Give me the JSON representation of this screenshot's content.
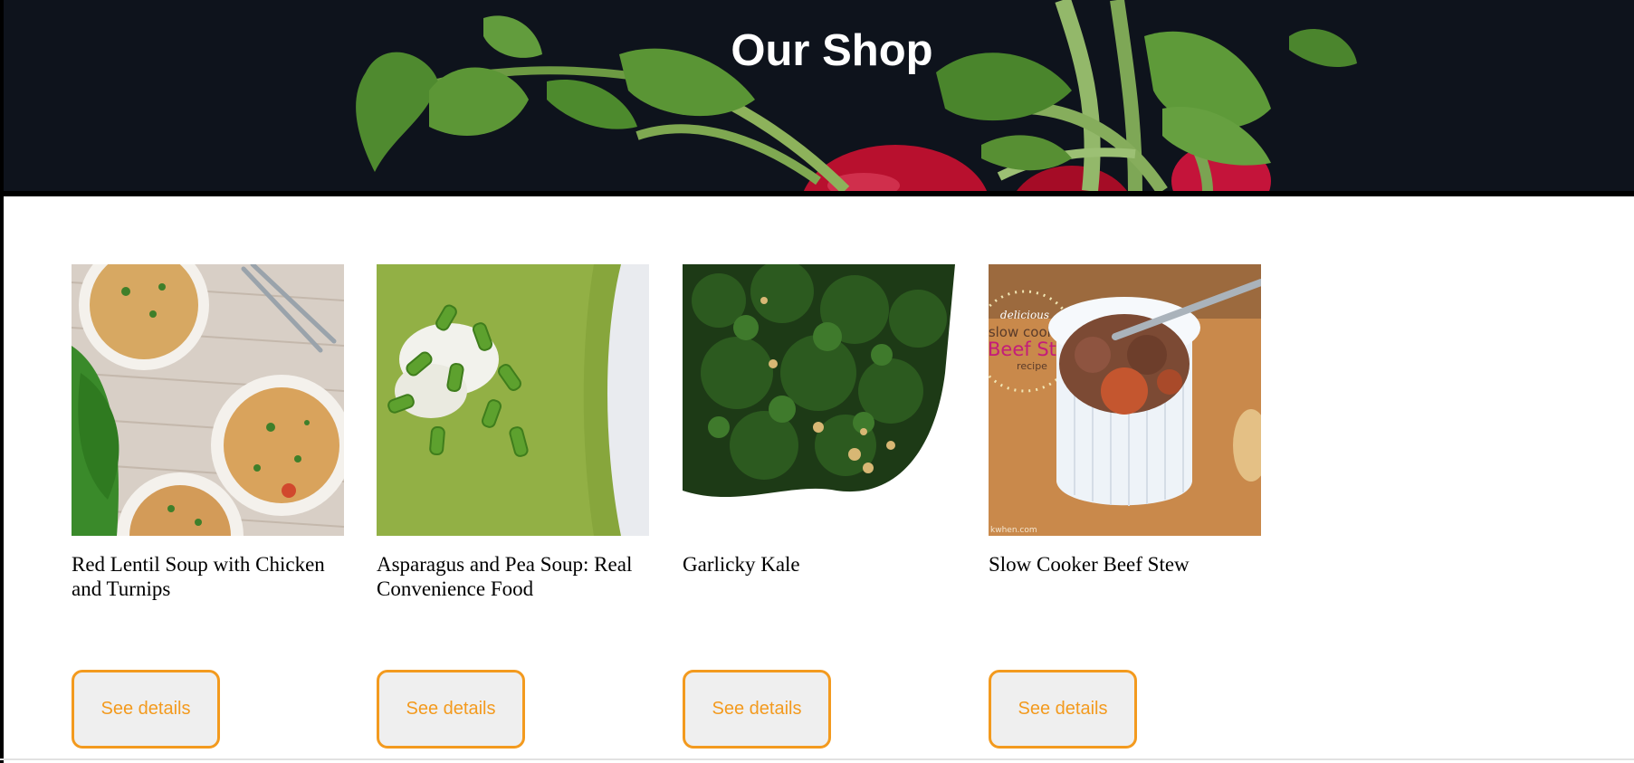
{
  "hero": {
    "title": "Our Shop",
    "background_color": "#0e131c"
  },
  "accent_color": "#f39a1e",
  "products": [
    {
      "title": "Red Lentil Soup with Chicken and Turnips",
      "button_label": "See details",
      "image": "red-lentil-soup-photo"
    },
    {
      "title": "Asparagus and Pea Soup: Real Convenience Food",
      "button_label": "See details",
      "image": "asparagus-pea-soup-photo"
    },
    {
      "title": "Garlicky Kale",
      "button_label": "See details",
      "image": "garlicky-kale-photo"
    },
    {
      "title": "Slow Cooker Beef Stew",
      "button_label": "See details",
      "image": "beef-stew-photo"
    }
  ],
  "beef_stew_image_text": {
    "line1": "delicious",
    "line2": "slow cooker",
    "line3": "Beef Stew",
    "line4": "recipe",
    "credit": "kwhen.com"
  }
}
